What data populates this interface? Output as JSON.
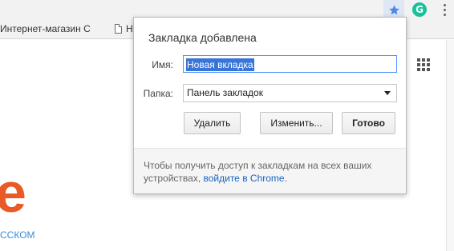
{
  "toolbar": {
    "star_icon": "bookmark-star-filled",
    "extension_icon": "grammarly-icon",
    "extension_glyph": "G",
    "menu_icon": "more-vertical-icon",
    "accent": "#4d87e8"
  },
  "bookmarks_bar": {
    "items": [
      {
        "label": "Интернет-магазин С"
      },
      {
        "label": "Но"
      }
    ]
  },
  "page": {
    "logo_letter": "e",
    "logo_subtitle": "ССКОМ",
    "logo_color": "#ea5a24"
  },
  "popup": {
    "title": "Закладка добавлена",
    "name_label": "Имя:",
    "name_value": "Новая вкладка",
    "folder_label": "Папка:",
    "folder_value": "Панель закладок",
    "buttons": {
      "remove": "Удалить",
      "edit": "Изменить...",
      "done": "Готово"
    },
    "footer_text": "Чтобы получить доступ к закладкам на всех ваших устройствах,",
    "footer_link": "войдите в Chrome",
    "footer_end": "."
  }
}
